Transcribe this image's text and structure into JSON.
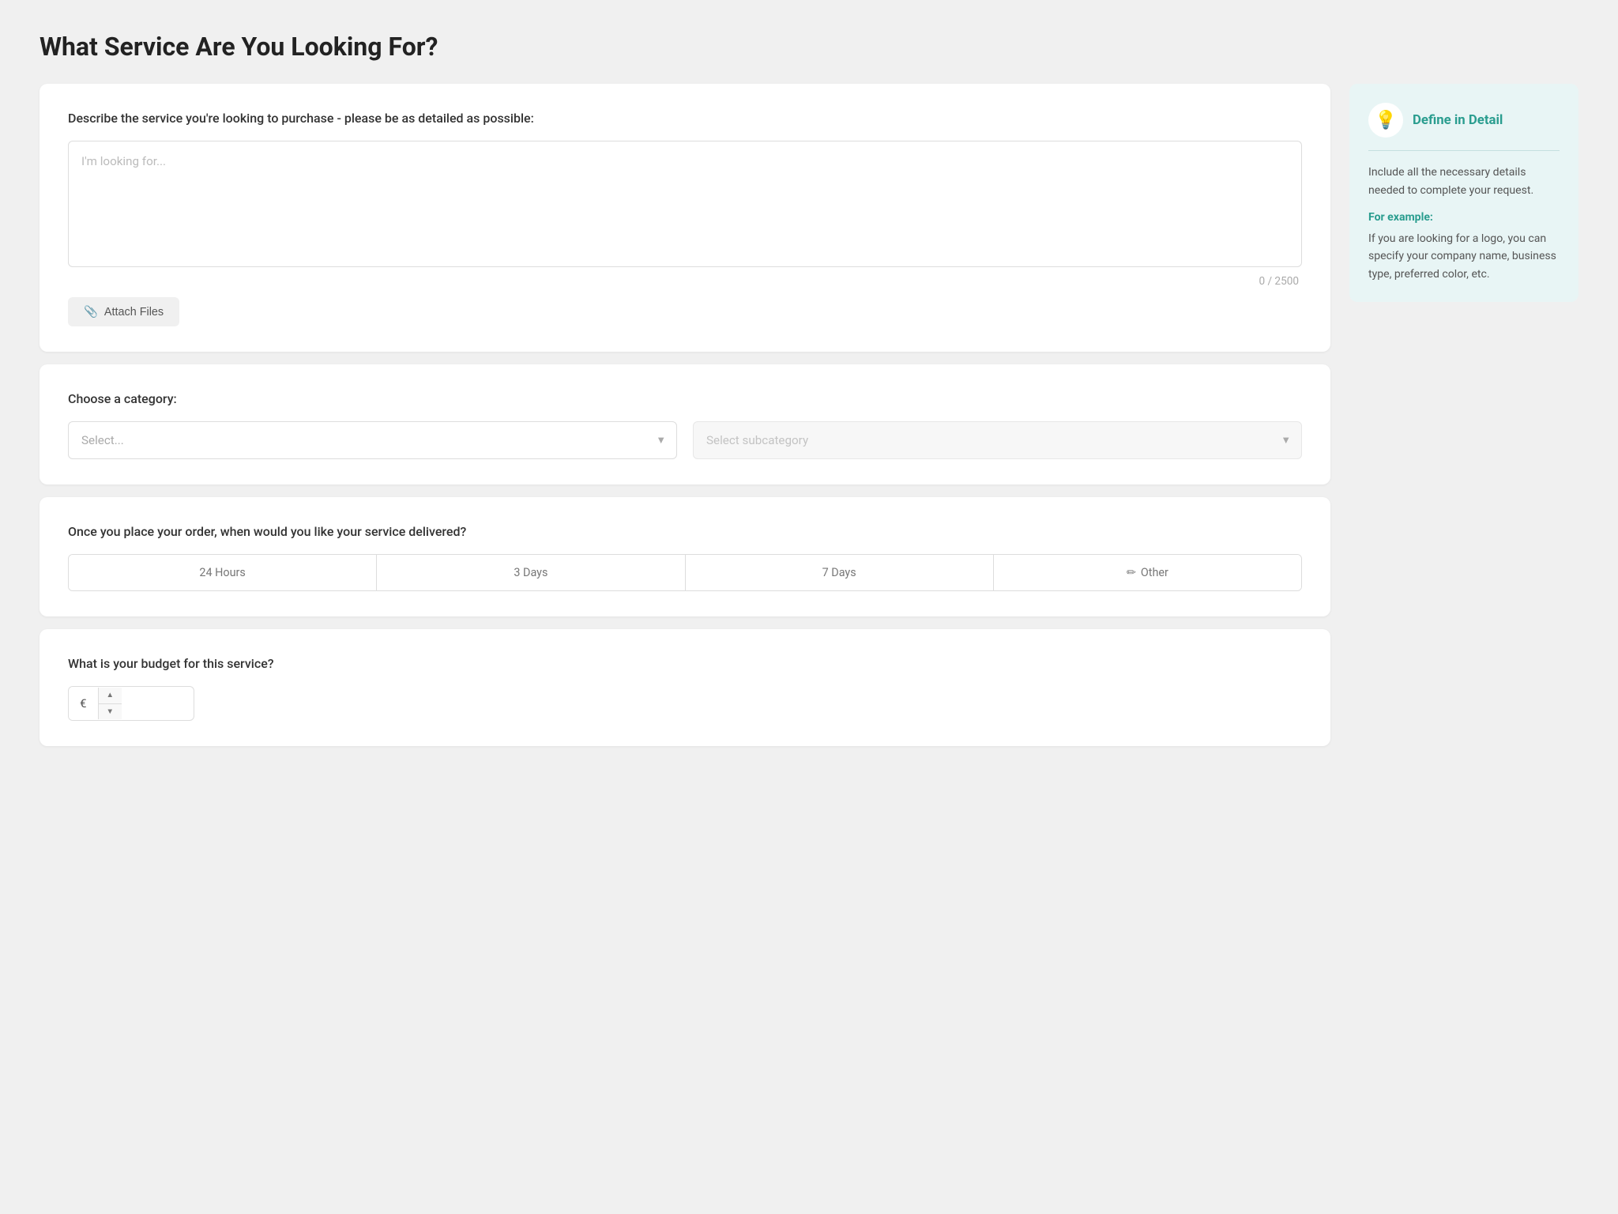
{
  "page": {
    "title": "What Service Are You Looking For?"
  },
  "description_section": {
    "label": "Describe the service you're looking to purchase - please be as detailed as possible:",
    "textarea_placeholder": "I'm looking for...",
    "char_count": "0 / 2500",
    "attach_button_label": "Attach Files"
  },
  "category_section": {
    "label": "Choose a category:",
    "category_placeholder": "Select...",
    "subcategory_placeholder": "Select subcategory"
  },
  "delivery_section": {
    "label": "Once you place your order, when would you like your service delivered?",
    "options": [
      {
        "label": "24 Hours",
        "icon": null
      },
      {
        "label": "3 Days",
        "icon": null
      },
      {
        "label": "7 Days",
        "icon": null
      },
      {
        "label": "Other",
        "icon": "✏"
      }
    ]
  },
  "budget_section": {
    "label": "What is your budget for this service?",
    "currency_symbol": "€"
  },
  "sidebar": {
    "title": "Define in Detail",
    "body": "Include all the necessary details needed to complete your request.",
    "for_example_label": "For example:",
    "example_text": "If you are looking for a logo, you can specify your company name, business type, preferred color, etc."
  }
}
